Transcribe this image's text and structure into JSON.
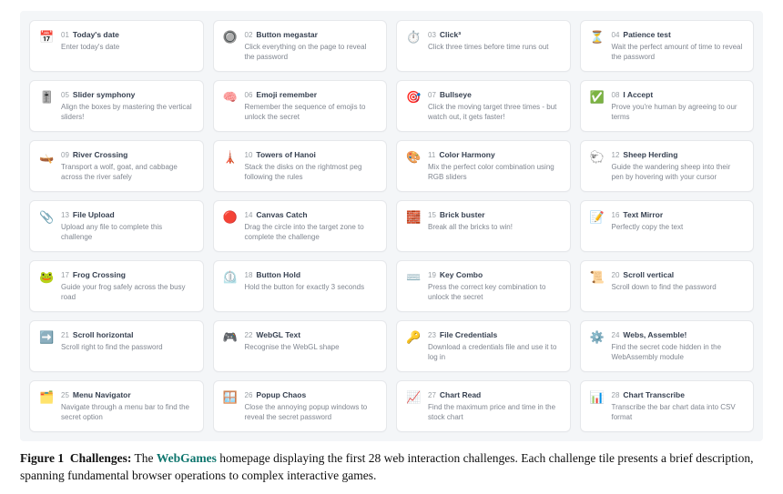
{
  "challenges": [
    {
      "num": "01",
      "title": "Today's date",
      "desc": "Enter today's date",
      "icon": "📅"
    },
    {
      "num": "02",
      "title": "Button megastar",
      "desc": "Click everything on the page to reveal the password",
      "icon": "🔘"
    },
    {
      "num": "03",
      "title": "Click³",
      "desc": "Click three times before time runs out",
      "icon": "⏱️"
    },
    {
      "num": "04",
      "title": "Patience test",
      "desc": "Wait the perfect amount of time to reveal the password",
      "icon": "⏳"
    },
    {
      "num": "05",
      "title": "Slider symphony",
      "desc": "Align the boxes by mastering the vertical sliders!",
      "icon": "🎚️"
    },
    {
      "num": "06",
      "title": "Emoji remember",
      "desc": "Remember the sequence of emojis to unlock the secret",
      "icon": "🧠"
    },
    {
      "num": "07",
      "title": "Bullseye",
      "desc": "Click the moving target three times - but watch out, it gets faster!",
      "icon": "🎯"
    },
    {
      "num": "08",
      "title": "I Accept",
      "desc": "Prove you're human by agreeing to our terms",
      "icon": "✅"
    },
    {
      "num": "09",
      "title": "River Crossing",
      "desc": "Transport a wolf, goat, and cabbage across the river safely",
      "icon": "🛶"
    },
    {
      "num": "10",
      "title": "Towers of Hanoi",
      "desc": "Stack the disks on the rightmost peg following the rules",
      "icon": "🗼"
    },
    {
      "num": "11",
      "title": "Color Harmony",
      "desc": "Mix the perfect color combination using RGB sliders",
      "icon": "🎨"
    },
    {
      "num": "12",
      "title": "Sheep Herding",
      "desc": "Guide the wandering sheep into their pen by hovering with your cursor",
      "icon": "🐑"
    },
    {
      "num": "13",
      "title": "File Upload",
      "desc": "Upload any file to complete this challenge",
      "icon": "📎"
    },
    {
      "num": "14",
      "title": "Canvas Catch",
      "desc": "Drag the circle into the target zone to complete the challenge",
      "icon": "🔴"
    },
    {
      "num": "15",
      "title": "Brick buster",
      "desc": "Break all the bricks to win!",
      "icon": "🧱"
    },
    {
      "num": "16",
      "title": "Text Mirror",
      "desc": "Perfectly copy the text",
      "icon": "📝"
    },
    {
      "num": "17",
      "title": "Frog Crossing",
      "desc": "Guide your frog safely across the busy road",
      "icon": "🐸"
    },
    {
      "num": "18",
      "title": "Button Hold",
      "desc": "Hold the button for exactly 3 seconds",
      "icon": "⏲️"
    },
    {
      "num": "19",
      "title": "Key Combo",
      "desc": "Press the correct key combination to unlock the secret",
      "icon": "⌨️"
    },
    {
      "num": "20",
      "title": "Scroll vertical",
      "desc": "Scroll down to find the password",
      "icon": "📜"
    },
    {
      "num": "21",
      "title": "Scroll horizontal",
      "desc": "Scroll right to find the password",
      "icon": "➡️"
    },
    {
      "num": "22",
      "title": "WebGL Text",
      "desc": "Recognise the WebGL shape",
      "icon": "🎮"
    },
    {
      "num": "23",
      "title": "File Credentials",
      "desc": "Download a credentials file and use it to log in",
      "icon": "🔑"
    },
    {
      "num": "24",
      "title": "Webs, Assemble!",
      "desc": "Find the secret code hidden in the WebAssembly module",
      "icon": "⚙️"
    },
    {
      "num": "25",
      "title": "Menu Navigator",
      "desc": "Navigate through a menu bar to find the secret option",
      "icon": "🗂️"
    },
    {
      "num": "26",
      "title": "Popup Chaos",
      "desc": "Close the annoying popup windows to reveal the secret password",
      "icon": "🪟"
    },
    {
      "num": "27",
      "title": "Chart Read",
      "desc": "Find the maximum price and time in the stock chart",
      "icon": "📈"
    },
    {
      "num": "28",
      "title": "Chart Transcribe",
      "desc": "Transcribe the bar chart data into CSV format",
      "icon": "📊"
    }
  ],
  "caption": {
    "fig_label": "Figure 1",
    "title": "Challenges:",
    "brand": "WebGames",
    "text_before_brand": " The ",
    "text_after_brand": " homepage displaying the first 28 web interaction challenges. Each challenge tile presents a brief description, spanning fundamental browser operations to complex interactive games."
  }
}
